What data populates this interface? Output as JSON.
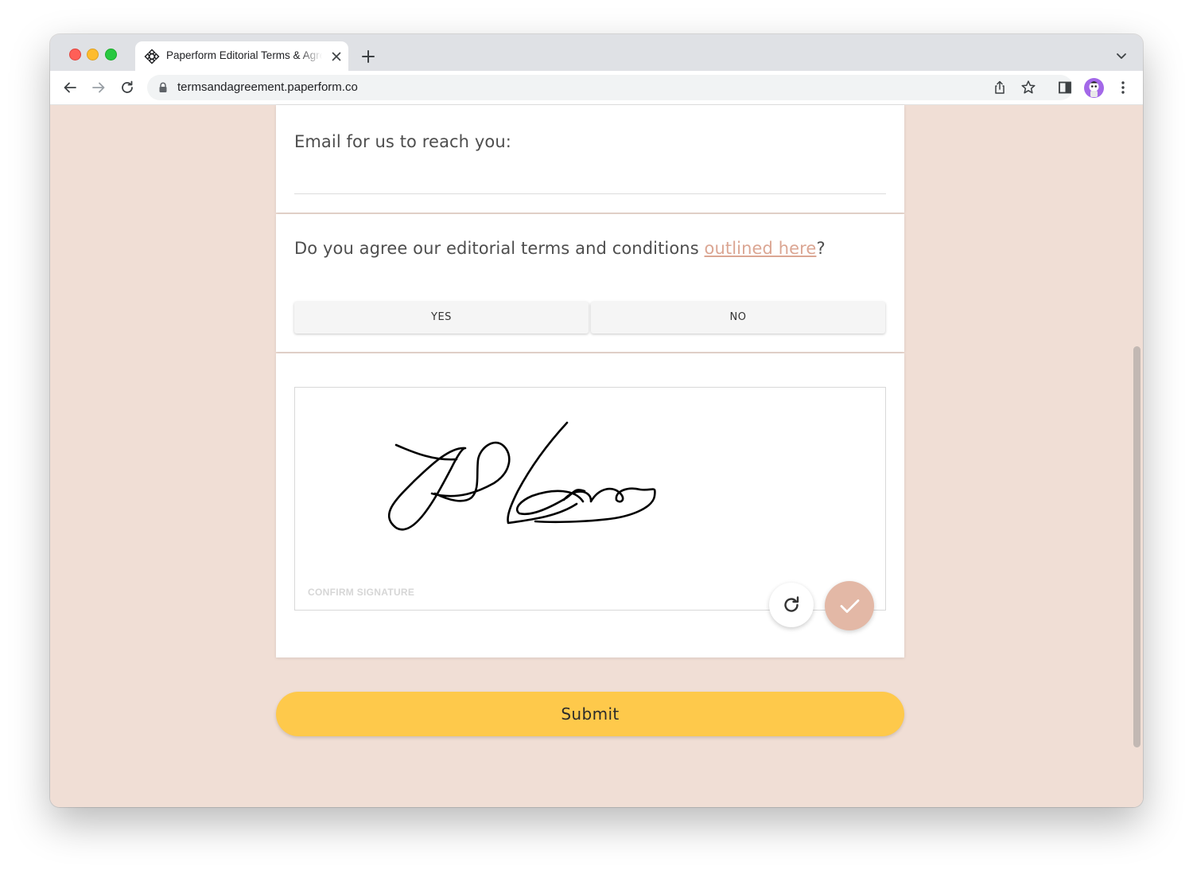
{
  "browser": {
    "tab_title": "Paperform Editorial Terms & Agreement",
    "url": "termsandagreement.paperform.co",
    "icons": [
      "paperform-favicon-icon",
      "close-icon",
      "plus-icon",
      "chevron-down-icon",
      "back-icon",
      "forward-icon",
      "reload-icon",
      "lock-icon",
      "share-icon",
      "star-icon",
      "sidebar-icon",
      "avatar",
      "kebab-menu-icon"
    ]
  },
  "form": {
    "email_question": "Email for us to reach you:",
    "terms_question_prefix": "Do you agree our editorial terms and conditions ",
    "terms_link": "outlined here",
    "terms_question_suffix": "?",
    "choices": {
      "yes": "YES",
      "no": "NO"
    },
    "signature": {
      "label": "CONFIRM SIGNATURE",
      "reset_icon": "refresh-icon",
      "confirm_icon": "check-icon"
    },
    "submit_label": "Submit"
  },
  "colors": {
    "page_background": "#f0ded5",
    "link": "#dba693",
    "submit_button": "#fec94b",
    "confirm_button": "#e3b8a6"
  }
}
